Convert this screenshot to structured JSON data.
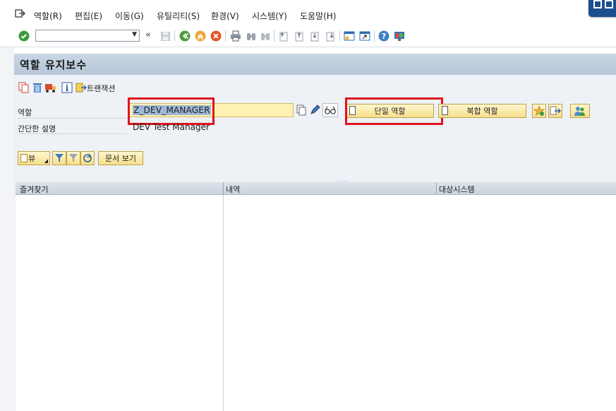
{
  "menubar": {
    "items": [
      "역할(R)",
      "편집(E)",
      "이동(G)",
      "유틸리티(S)",
      "환경(V)",
      "시스템(Y)",
      "도움말(H)"
    ]
  },
  "toolbar": {
    "command_value": "",
    "back_label": "«"
  },
  "header": {
    "title": "역할 유지보수"
  },
  "app_toolbar": {
    "transaction_label": "트랜잭션"
  },
  "form": {
    "role_label": "역할",
    "role_value": "Z_DEV_MANAGER",
    "short_desc_label": "간단한 설명",
    "short_desc_value": "DEV Test Manager",
    "single_role_button": "단일 역할",
    "composite_role_button": "복합 역할"
  },
  "view_toolbar": {
    "view_label": "뷰",
    "doc_view_label": "문서 보기"
  },
  "tree": {
    "columns": [
      "즐겨찾기",
      "내역",
      "대상시스템"
    ],
    "grip": "....."
  },
  "colors": {
    "title_bar": "#c2d0df",
    "input_bg": "#fff2b2",
    "highlight_box": "#e0141e",
    "accent_button": "#f6df8a"
  },
  "icons": {
    "menu": "exit-icon",
    "toolbar": [
      "enter-check-icon",
      "back-icon",
      "save-icon",
      "green-back-icon",
      "exit-icon",
      "cancel-icon",
      "print-icon",
      "find-icon",
      "find-next-icon",
      "first-page-icon",
      "prev-page-icon",
      "next-page-icon",
      "last-page-icon",
      "create-session-icon",
      "shortcut-icon",
      "help-icon",
      "customize-layout-icon"
    ]
  }
}
